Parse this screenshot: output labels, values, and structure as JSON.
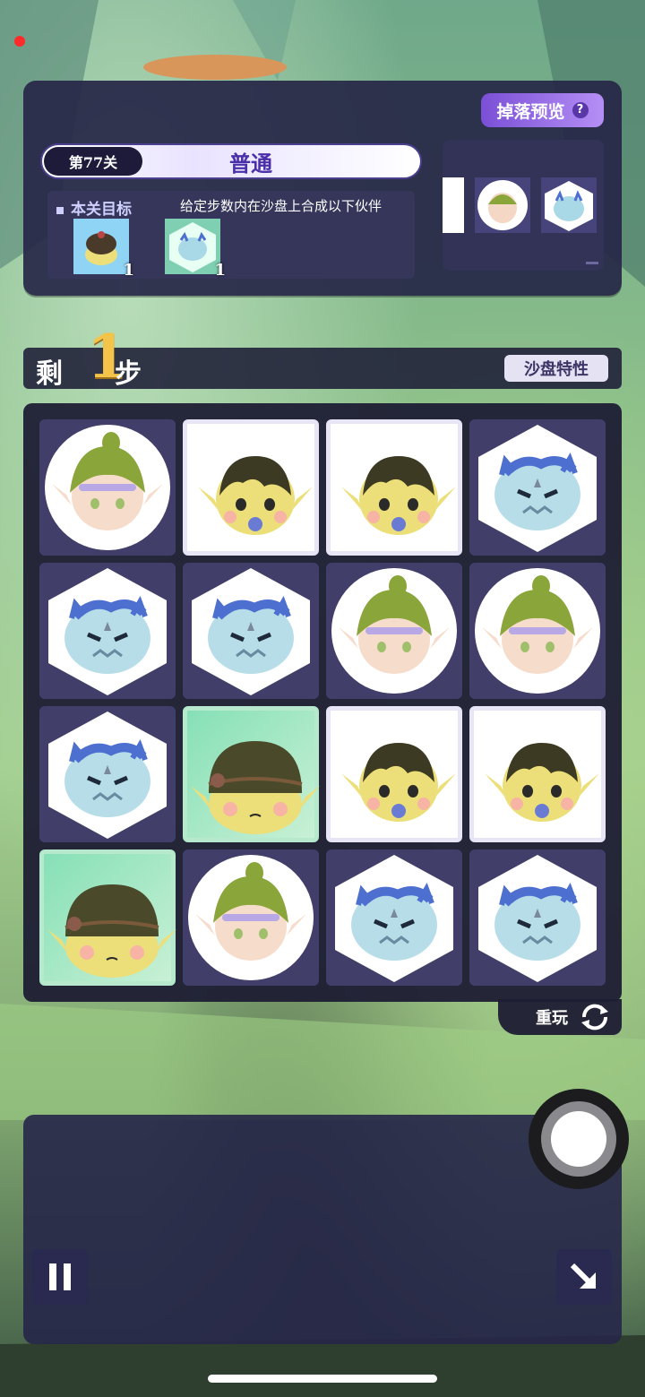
{
  "header": {
    "drop_preview_label": "掉落预览",
    "drop_preview_help": "?",
    "level_tag": "第77关",
    "level_mode": "普通"
  },
  "goal": {
    "title": "本关目标",
    "description": "给定步数内在沙盘上合成以下伙伴",
    "items": [
      {
        "icon": "helmet-goblin-icon",
        "count": "1"
      },
      {
        "icon": "blue-slime-icon",
        "count": "1"
      }
    ]
  },
  "preview_icons": [
    "elf-circle-icon",
    "slime-hex-icon"
  ],
  "steps": {
    "prefix": "剩",
    "value": "1",
    "suffix": "步",
    "sand_traits_label": "沙盘特性"
  },
  "board": {
    "rows": [
      [
        "elf",
        "goblin",
        "goblin",
        "slime"
      ],
      [
        "slime",
        "slime",
        "elf",
        "elf"
      ],
      [
        "slime",
        "helmet",
        "goblin",
        "goblin"
      ],
      [
        "helmet",
        "elf",
        "slime",
        "slime"
      ]
    ]
  },
  "replay_label": "重玩",
  "colors": {
    "accent_purple": "#7b4fd6",
    "steps_gold": "#f3c34a",
    "panel": "#262646"
  }
}
